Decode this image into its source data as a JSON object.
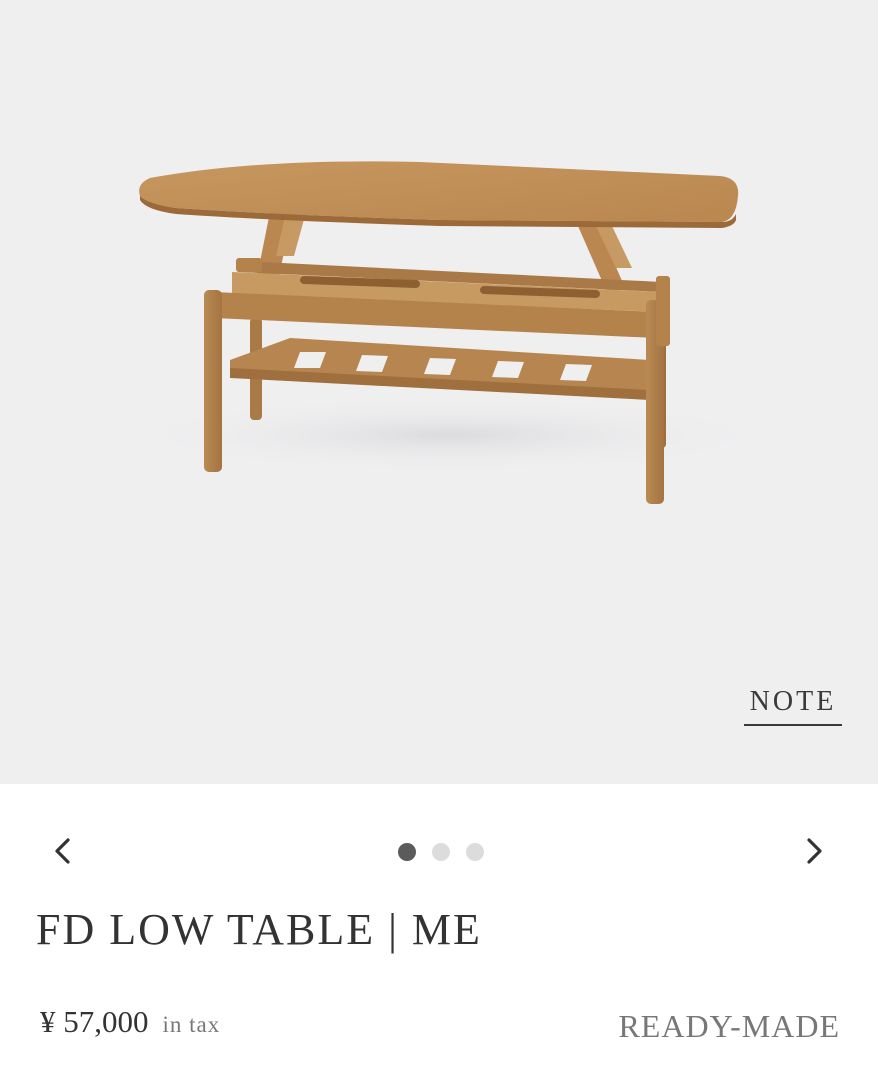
{
  "hero": {
    "background": "#efeff0",
    "image_name": "fd-low-table-photo",
    "note_label": "NOTE"
  },
  "carousel": {
    "slide_count": 3,
    "active_index": 0,
    "prev_icon": "chevron-left-icon",
    "next_icon": "chevron-right-icon"
  },
  "product": {
    "title": "FD LOW TABLE | ME",
    "price": "¥ 57,000",
    "tax_note": "in tax",
    "type_label": "READY-MADE"
  },
  "colors": {
    "wood_light": "#c08f55",
    "wood_dark": "#9b6a38",
    "text": "#333333",
    "muted": "#777777"
  }
}
